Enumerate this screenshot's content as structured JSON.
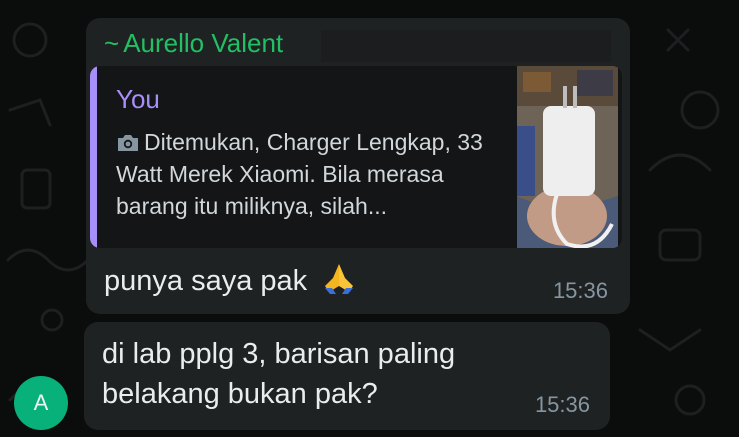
{
  "chat": {
    "messages": [
      {
        "sender": "Aurello Valent",
        "sender_prefix": "~",
        "reply": {
          "author": "You",
          "text": "Ditemukan, Charger Lengkap, 33 Watt Merek Xiaomi. Bila merasa barang itu miliknya, silah...",
          "media_icon": "camera-icon"
        },
        "text": "punya saya pak",
        "emoji": "folded-hands-icon",
        "time": "15:36"
      },
      {
        "text": "di lab pplg 3, barisan paling belakang bukan pak?",
        "time": "15:36"
      }
    ],
    "avatar_initial": "A"
  },
  "colors": {
    "sender_name": "#21c063",
    "quote_accent": "#a88ef8",
    "bubble": "#1f2223",
    "avatar": "#08b07a"
  }
}
